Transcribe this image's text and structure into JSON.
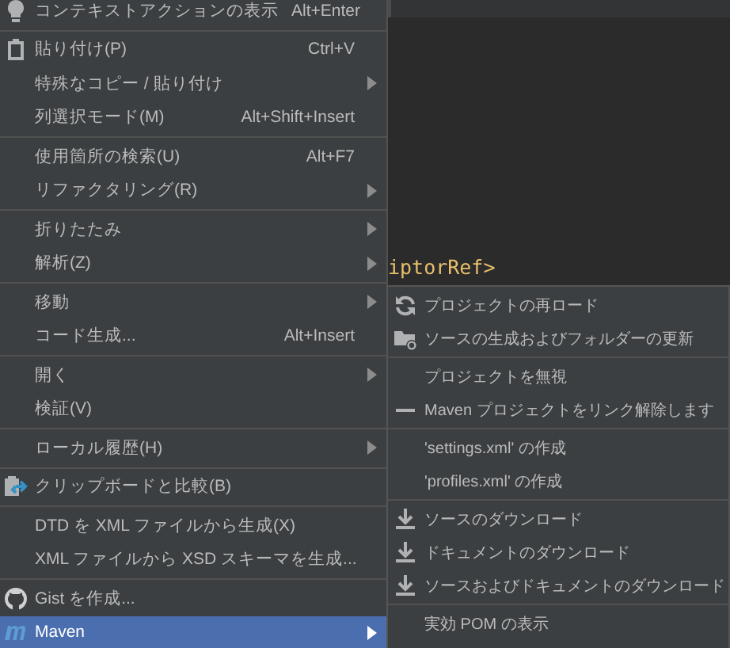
{
  "editor": {
    "code_fragment": "iptorRef>"
  },
  "context_menu": {
    "groups": [
      [
        {
          "label": "コンテキストアクションの表示",
          "shortcut": "Alt+Enter",
          "submenu": false,
          "selected": false
        }
      ],
      [
        {
          "label": "貼り付け(P)",
          "shortcut": "Ctrl+V",
          "submenu": false,
          "selected": false
        },
        {
          "label": "特殊なコピー / 貼り付け",
          "submenu": true,
          "selected": false
        },
        {
          "label": "列選択モード(M)",
          "shortcut": "Alt+Shift+Insert",
          "submenu": false,
          "selected": false
        }
      ],
      [
        {
          "label": "使用箇所の検索(U)",
          "shortcut": "Alt+F7",
          "submenu": false,
          "selected": false
        },
        {
          "label": "リファクタリング(R)",
          "submenu": true,
          "selected": false
        }
      ],
      [
        {
          "label": "折りたたみ",
          "submenu": true,
          "selected": false
        },
        {
          "label": "解析(Z)",
          "submenu": true,
          "selected": false
        }
      ],
      [
        {
          "label": "移動",
          "submenu": true,
          "selected": false
        },
        {
          "label": "コード生成...",
          "shortcut": "Alt+Insert",
          "submenu": false,
          "selected": false
        }
      ],
      [
        {
          "label": "開く",
          "submenu": true,
          "selected": false
        },
        {
          "label": "検証(V)",
          "submenu": false,
          "selected": false
        }
      ],
      [
        {
          "label": "ローカル履歴(H)",
          "submenu": true,
          "selected": false
        }
      ],
      [
        {
          "label": "クリップボードと比較(B)",
          "submenu": false,
          "selected": false
        }
      ],
      [
        {
          "label": "DTD を XML ファイルから生成(X)",
          "submenu": false,
          "selected": false
        },
        {
          "label": "XML ファイルから XSD スキーマを生成...",
          "submenu": false,
          "selected": false
        }
      ],
      [
        {
          "label": "Gist を作成...",
          "submenu": false,
          "selected": false
        },
        {
          "label": "Maven",
          "submenu": true,
          "selected": true
        }
      ]
    ]
  },
  "submenu": {
    "groups": [
      [
        {
          "label": "プロジェクトの再ロード"
        },
        {
          "label": "ソースの生成およびフォルダーの更新"
        }
      ],
      [
        {
          "label": "プロジェクトを無視"
        },
        {
          "label": "Maven プロジェクトをリンク解除します"
        }
      ],
      [
        {
          "label": "'settings.xml' の作成"
        },
        {
          "label": "'profiles.xml' の作成"
        }
      ],
      [
        {
          "label": "ソースのダウンロード"
        },
        {
          "label": "ドキュメントのダウンロード"
        },
        {
          "label": "ソースおよびドキュメントのダウンロード"
        }
      ],
      [
        {
          "label": "実効 POM の表示"
        }
      ]
    ]
  }
}
